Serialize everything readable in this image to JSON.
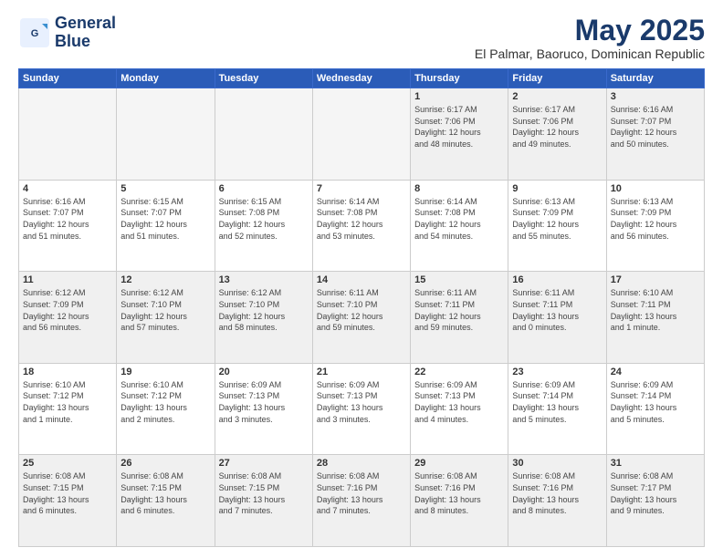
{
  "logo": {
    "line1": "General",
    "line2": "Blue"
  },
  "title": "May 2025",
  "subtitle": "El Palmar, Baoruco, Dominican Republic",
  "days_of_week": [
    "Sunday",
    "Monday",
    "Tuesday",
    "Wednesday",
    "Thursday",
    "Friday",
    "Saturday"
  ],
  "weeks": [
    [
      {
        "day": "",
        "info": "",
        "empty": true
      },
      {
        "day": "",
        "info": "",
        "empty": true
      },
      {
        "day": "",
        "info": "",
        "empty": true
      },
      {
        "day": "",
        "info": "",
        "empty": true
      },
      {
        "day": "1",
        "info": "Sunrise: 6:17 AM\nSunset: 7:06 PM\nDaylight: 12 hours\nand 48 minutes."
      },
      {
        "day": "2",
        "info": "Sunrise: 6:17 AM\nSunset: 7:06 PM\nDaylight: 12 hours\nand 49 minutes."
      },
      {
        "day": "3",
        "info": "Sunrise: 6:16 AM\nSunset: 7:07 PM\nDaylight: 12 hours\nand 50 minutes."
      }
    ],
    [
      {
        "day": "4",
        "info": "Sunrise: 6:16 AM\nSunset: 7:07 PM\nDaylight: 12 hours\nand 51 minutes."
      },
      {
        "day": "5",
        "info": "Sunrise: 6:15 AM\nSunset: 7:07 PM\nDaylight: 12 hours\nand 51 minutes."
      },
      {
        "day": "6",
        "info": "Sunrise: 6:15 AM\nSunset: 7:08 PM\nDaylight: 12 hours\nand 52 minutes."
      },
      {
        "day": "7",
        "info": "Sunrise: 6:14 AM\nSunset: 7:08 PM\nDaylight: 12 hours\nand 53 minutes."
      },
      {
        "day": "8",
        "info": "Sunrise: 6:14 AM\nSunset: 7:08 PM\nDaylight: 12 hours\nand 54 minutes."
      },
      {
        "day": "9",
        "info": "Sunrise: 6:13 AM\nSunset: 7:09 PM\nDaylight: 12 hours\nand 55 minutes."
      },
      {
        "day": "10",
        "info": "Sunrise: 6:13 AM\nSunset: 7:09 PM\nDaylight: 12 hours\nand 56 minutes."
      }
    ],
    [
      {
        "day": "11",
        "info": "Sunrise: 6:12 AM\nSunset: 7:09 PM\nDaylight: 12 hours\nand 56 minutes."
      },
      {
        "day": "12",
        "info": "Sunrise: 6:12 AM\nSunset: 7:10 PM\nDaylight: 12 hours\nand 57 minutes."
      },
      {
        "day": "13",
        "info": "Sunrise: 6:12 AM\nSunset: 7:10 PM\nDaylight: 12 hours\nand 58 minutes."
      },
      {
        "day": "14",
        "info": "Sunrise: 6:11 AM\nSunset: 7:10 PM\nDaylight: 12 hours\nand 59 minutes."
      },
      {
        "day": "15",
        "info": "Sunrise: 6:11 AM\nSunset: 7:11 PM\nDaylight: 12 hours\nand 59 minutes."
      },
      {
        "day": "16",
        "info": "Sunrise: 6:11 AM\nSunset: 7:11 PM\nDaylight: 13 hours\nand 0 minutes."
      },
      {
        "day": "17",
        "info": "Sunrise: 6:10 AM\nSunset: 7:11 PM\nDaylight: 13 hours\nand 1 minute."
      }
    ],
    [
      {
        "day": "18",
        "info": "Sunrise: 6:10 AM\nSunset: 7:12 PM\nDaylight: 13 hours\nand 1 minute."
      },
      {
        "day": "19",
        "info": "Sunrise: 6:10 AM\nSunset: 7:12 PM\nDaylight: 13 hours\nand 2 minutes."
      },
      {
        "day": "20",
        "info": "Sunrise: 6:09 AM\nSunset: 7:13 PM\nDaylight: 13 hours\nand 3 minutes."
      },
      {
        "day": "21",
        "info": "Sunrise: 6:09 AM\nSunset: 7:13 PM\nDaylight: 13 hours\nand 3 minutes."
      },
      {
        "day": "22",
        "info": "Sunrise: 6:09 AM\nSunset: 7:13 PM\nDaylight: 13 hours\nand 4 minutes."
      },
      {
        "day": "23",
        "info": "Sunrise: 6:09 AM\nSunset: 7:14 PM\nDaylight: 13 hours\nand 5 minutes."
      },
      {
        "day": "24",
        "info": "Sunrise: 6:09 AM\nSunset: 7:14 PM\nDaylight: 13 hours\nand 5 minutes."
      }
    ],
    [
      {
        "day": "25",
        "info": "Sunrise: 6:08 AM\nSunset: 7:15 PM\nDaylight: 13 hours\nand 6 minutes."
      },
      {
        "day": "26",
        "info": "Sunrise: 6:08 AM\nSunset: 7:15 PM\nDaylight: 13 hours\nand 6 minutes."
      },
      {
        "day": "27",
        "info": "Sunrise: 6:08 AM\nSunset: 7:15 PM\nDaylight: 13 hours\nand 7 minutes."
      },
      {
        "day": "28",
        "info": "Sunrise: 6:08 AM\nSunset: 7:16 PM\nDaylight: 13 hours\nand 7 minutes."
      },
      {
        "day": "29",
        "info": "Sunrise: 6:08 AM\nSunset: 7:16 PM\nDaylight: 13 hours\nand 8 minutes."
      },
      {
        "day": "30",
        "info": "Sunrise: 6:08 AM\nSunset: 7:16 PM\nDaylight: 13 hours\nand 8 minutes."
      },
      {
        "day": "31",
        "info": "Sunrise: 6:08 AM\nSunset: 7:17 PM\nDaylight: 13 hours\nand 9 minutes."
      }
    ]
  ]
}
